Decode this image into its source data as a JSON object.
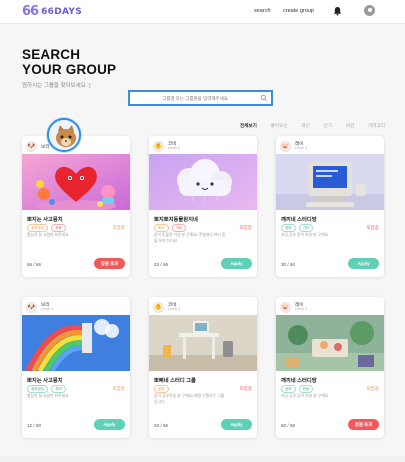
{
  "header": {
    "logo_mark": "66",
    "logo_text": "66DAYS",
    "nav_search": "search",
    "nav_create": "create group",
    "bell_icon": "bell-icon",
    "profile_icon": "user-avatar-icon"
  },
  "hero": {
    "title": "SEARCH\nYOUR GROUP",
    "subtitle": "원하시는 그룹을 찾아보세요 :)"
  },
  "search": {
    "placeholder": "그룹명 또는 그룹원을 입력해주세요",
    "value": "",
    "icon": "search-icon",
    "border_color": "#3b8ddf"
  },
  "sort_options": [
    "전체보기",
    "좋아요순",
    "최신",
    "인기",
    "마감",
    "카테고리"
  ],
  "cards": [
    {
      "owner": "보리",
      "level": "",
      "title": "뽀지는 사고뭉치",
      "tags": [
        "정보공유",
        "운동"
      ],
      "tag_styles": [
        "orange",
        "red"
      ],
      "status": "모집중",
      "desc": "열심히 잘 사람만 와주세요",
      "count": "56 / 56",
      "button": "정원 초과",
      "button_style": "red",
      "image": "heart-character"
    },
    {
      "owner": "코비",
      "level": "Level 5",
      "title": "뽀지뽀지동물원지네",
      "tags": [
        "독서",
        "기타"
      ],
      "tag_styles": [
        "orange",
        "red"
      ],
      "status": "모집중",
      "desc": "같이 동물원 가실 분 구해요! 주말마다 여러 동물 보러 다녀요",
      "count": "33 / 66",
      "button": "Apply",
      "button_style": "green",
      "image": "cloud-character"
    },
    {
      "owner": "레이",
      "level": "Level 3",
      "title": "깨끼네 스터디방",
      "tags": [
        "공부",
        "기타"
      ],
      "tag_styles": [
        "green",
        "green"
      ],
      "status": "모집중",
      "desc": "코딩 공부 같이 하실 분 구해요",
      "count": "30 / 50",
      "button": "Apply",
      "button_style": "green",
      "image": "retro-computer"
    },
    {
      "owner": "보리",
      "level": "Level 4",
      "title": "뽀지는 사고뭉치",
      "tags": [
        "정보공유",
        "취미"
      ],
      "tag_styles": [
        "green",
        "green"
      ],
      "status": "모집중",
      "desc": "열심히 잘 사람만 와주세요",
      "count": "12 / 50",
      "button": "Apply",
      "button_style": "green",
      "image": "rainbow"
    },
    {
      "owner": "코비",
      "level": "Level 3",
      "title": "뽀삐네 스터디 그룹",
      "tags": [
        "공부"
      ],
      "tag_styles": [
        "orange"
      ],
      "status": "모집중",
      "desc": "같이 공부하실 분 구해요! 매일 인증하는 그룹입니다",
      "count": "33 / 66",
      "button": "Apply",
      "button_style": "green",
      "image": "desk-room"
    },
    {
      "owner": "레이",
      "level": "Level 3",
      "title": "깨끼네 스터디방",
      "tags": [
        "공부",
        "운동"
      ],
      "tag_styles": [
        "green",
        "green"
      ],
      "status": "모집중",
      "desc": "코딩 공부 같이 하실 분 구해요",
      "count": "60 / 60",
      "button": "정원 초과",
      "button_style": "red",
      "image": "cozy-room"
    }
  ],
  "floating_avatar": "cat-avatar"
}
